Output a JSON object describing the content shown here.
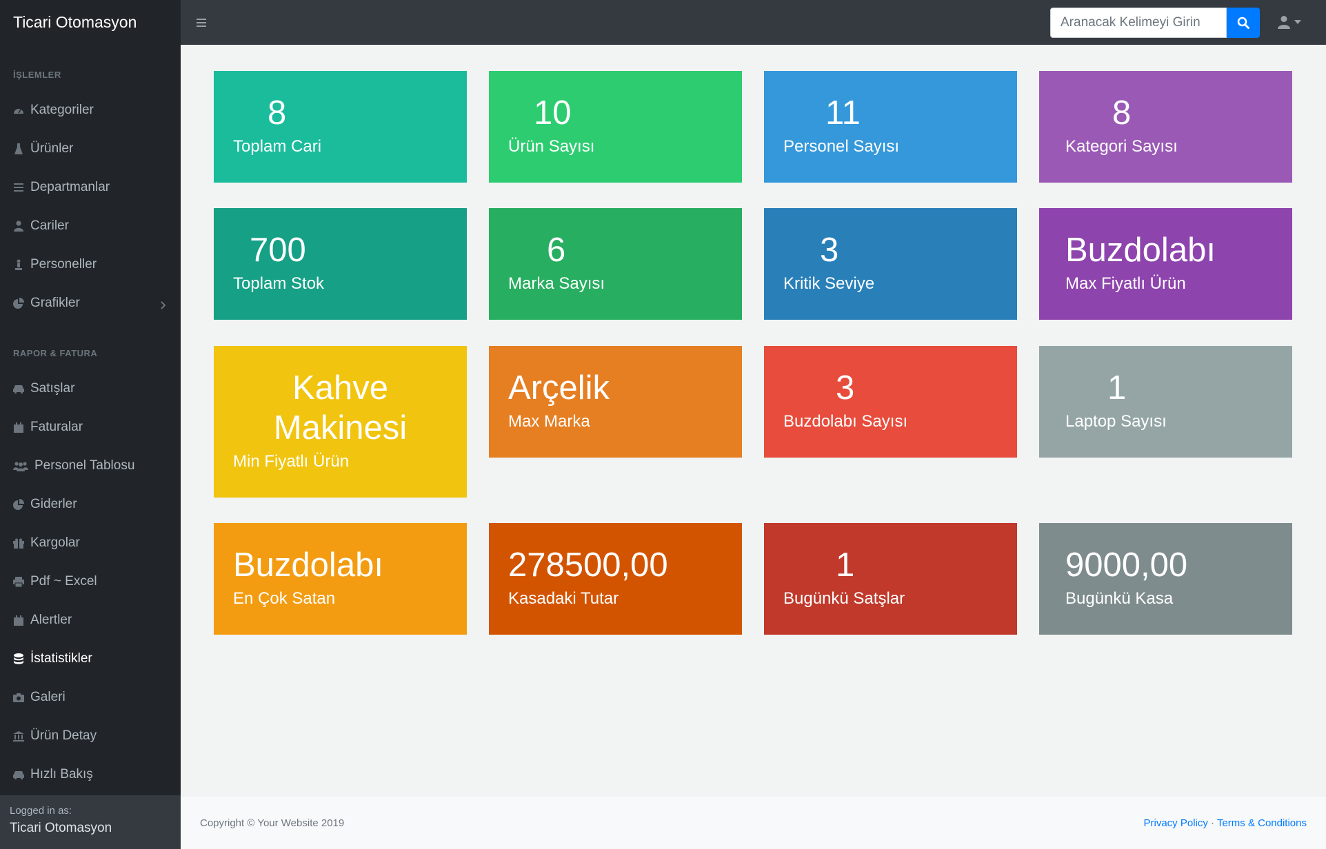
{
  "app": {
    "title": "Ticari Otomasyon"
  },
  "search": {
    "placeholder": "Aranacak Kelimeyi Girin"
  },
  "sidebar": {
    "heading_islemler": "İŞLEMLER",
    "heading_rapor": "RAPOR & FATURA",
    "items": [
      {
        "label": "Kategoriler",
        "icon": "dashboard-icon"
      },
      {
        "label": "Ürünler",
        "icon": "flask-icon"
      },
      {
        "label": "Departmanlar",
        "icon": "bars-icon"
      },
      {
        "label": "Cariler",
        "icon": "user-icon"
      },
      {
        "label": "Personeller",
        "icon": "person-icon"
      },
      {
        "label": "Grafikler",
        "icon": "pie-chart-icon"
      },
      {
        "label": "Satışlar",
        "icon": "car-icon"
      },
      {
        "label": "Faturalar",
        "icon": "calendar-icon"
      },
      {
        "label": "Personel Tablosu",
        "icon": "users-icon"
      },
      {
        "label": "Giderler",
        "icon": "pie-chart-icon"
      },
      {
        "label": "Kargolar",
        "icon": "gift-icon"
      },
      {
        "label": "Pdf ~ Excel",
        "icon": "print-icon"
      },
      {
        "label": "Alertler",
        "icon": "calendar-icon"
      },
      {
        "label": "İstatistikler",
        "icon": "database-icon"
      },
      {
        "label": "Galeri",
        "icon": "camera-icon"
      },
      {
        "label": "Ürün Detay",
        "icon": "bank-icon"
      },
      {
        "label": "Hızlı Bakış",
        "icon": "car-icon"
      }
    ],
    "footer": {
      "logged_in_as": "Logged in as:",
      "user": "Ticari Otomasyon"
    }
  },
  "cards": [
    {
      "value": "8",
      "label": "Toplam Cari",
      "color": "#1abc9c"
    },
    {
      "value": "10",
      "label": "Ürün Sayısı",
      "color": "#2ecc71"
    },
    {
      "value": "11",
      "label": "Personel Sayısı",
      "color": "#3498db"
    },
    {
      "value": "8",
      "label": "Kategori Sayısı",
      "color": "#9b59b6"
    },
    {
      "value": "700",
      "label": "Toplam Stok",
      "color": "#16a085"
    },
    {
      "value": "6",
      "label": "Marka Sayısı",
      "color": "#27ae60"
    },
    {
      "value": "3",
      "label": "Kritik Seviye",
      "color": "#2980b9"
    },
    {
      "value": "Buzdolabı",
      "label": "Max Fiyatlı Ürün",
      "color": "#8e44ad"
    },
    {
      "value_line1": "Kahve",
      "value_line2": "Makinesi",
      "label": "Min Fiyatlı Ürün",
      "color": "#f1c40f"
    },
    {
      "value": "Arçelik",
      "label": "Max Marka",
      "color": "#e67e22"
    },
    {
      "value": "3",
      "label": "Buzdolabı Sayısı",
      "color": "#e74c3c"
    },
    {
      "value": "1",
      "label": "Laptop Sayısı",
      "color": "#95a5a6"
    },
    {
      "value": "Buzdolabı",
      "label": "En Çok Satan",
      "color": "#f39c12"
    },
    {
      "value": "278500,00",
      "label": "Kasadaki Tutar",
      "color": "#d35400"
    },
    {
      "value": "1",
      "label": "Bugünkü Satşlar",
      "color": "#c0392b"
    },
    {
      "value": "9000,00",
      "label": "Bugünkü Kasa",
      "color": "#7f8c8d"
    }
  ],
  "footer": {
    "copyright": "Copyright © Your Website 2019",
    "privacy": "Privacy Policy",
    "separator": "·",
    "terms": "Terms & Conditions"
  },
  "colors": {
    "accent": "#007bff",
    "topbar": "#343a40",
    "sidebar": "#212529"
  }
}
